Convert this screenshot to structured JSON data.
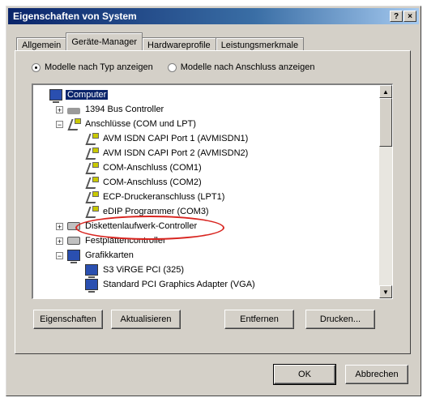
{
  "window": {
    "title": "Eigenschaften von System",
    "help_label": "?",
    "close_label": "×"
  },
  "tabs": [
    "Allgemein",
    "Geräte-Manager",
    "Hardwareprofile",
    "Leistungsmerkmale"
  ],
  "view_options": {
    "by_type": "Modelle nach Typ anzeigen",
    "by_connection": "Modelle nach Anschluss anzeigen",
    "selected": "by_type"
  },
  "tree": [
    {
      "label": "Computer",
      "indent": 0,
      "icon": "monitor-icon",
      "expander": "",
      "selected": true
    },
    {
      "label": "1394 Bus Controller",
      "indent": 1,
      "icon": "bus-icon",
      "expander": "+"
    },
    {
      "label": "Anschlüsse (COM und LPT)",
      "indent": 1,
      "icon": "port-icon",
      "expander": "-"
    },
    {
      "label": "AVM ISDN CAPI Port 1 (AVMISDN1)",
      "indent": 2,
      "icon": "plug-icon",
      "expander": ""
    },
    {
      "label": "AVM ISDN CAPI Port 2 (AVMISDN2)",
      "indent": 2,
      "icon": "plug-icon",
      "expander": ""
    },
    {
      "label": "COM-Anschluss (COM1)",
      "indent": 2,
      "icon": "plug-icon",
      "expander": ""
    },
    {
      "label": "COM-Anschluss (COM2)",
      "indent": 2,
      "icon": "plug-icon",
      "expander": ""
    },
    {
      "label": "ECP-Druckeranschluss (LPT1)",
      "indent": 2,
      "icon": "plug-icon",
      "expander": ""
    },
    {
      "label": "eDIP Programmer (COM3)",
      "indent": 2,
      "icon": "plug-icon",
      "expander": ""
    },
    {
      "label": "Diskettenlaufwerk-Controller",
      "indent": 1,
      "icon": "disk-icon",
      "expander": "+"
    },
    {
      "label": "Festplattencontroller",
      "indent": 1,
      "icon": "disk-icon",
      "expander": "+"
    },
    {
      "label": "Grafikkarten",
      "indent": 1,
      "icon": "monitor-icon",
      "expander": "-"
    },
    {
      "label": "S3 ViRGE PCI (325)",
      "indent": 2,
      "icon": "monitor-icon",
      "expander": ""
    },
    {
      "label": "Standard PCI Graphics Adapter (VGA)",
      "indent": 2,
      "icon": "monitor-icon",
      "expander": ""
    }
  ],
  "buttons": {
    "properties": "Eigenschaften",
    "refresh": "Aktualisieren",
    "remove": "Entfernen",
    "print": "Drucken...",
    "ok": "OK",
    "cancel": "Abbrechen"
  },
  "colors": {
    "highlight": "#d8241f",
    "selection": "#0a246a"
  }
}
